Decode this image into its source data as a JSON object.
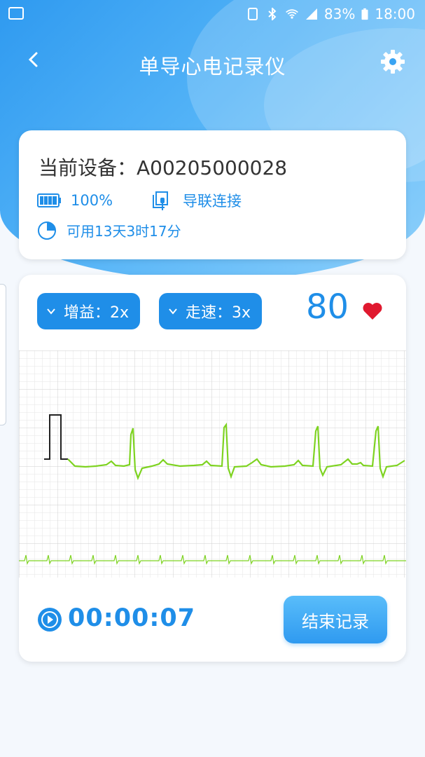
{
  "status_bar": {
    "battery_pct": "83%",
    "time": "18:00"
  },
  "header": {
    "title": "单导心电记录仪"
  },
  "device": {
    "label": "当前设备：A00205000028",
    "battery": "100%",
    "lead_status": "导联连接",
    "remaining": "可用13天3时17分"
  },
  "ecg": {
    "gain_label": "增益：2x",
    "speed_label": "走速：3x",
    "heart_rate": "80",
    "timer": "00:00:07",
    "end_button": "结束记录"
  },
  "colors": {
    "primary": "#1f8ee8",
    "ecg_line": "#7ed321",
    "heart": "#e0192f"
  },
  "icons": [
    "back-icon",
    "gear-icon",
    "battery-icon",
    "lead-icon",
    "clock-icon",
    "chevron-down-icon",
    "heart-icon",
    "play-icon"
  ]
}
